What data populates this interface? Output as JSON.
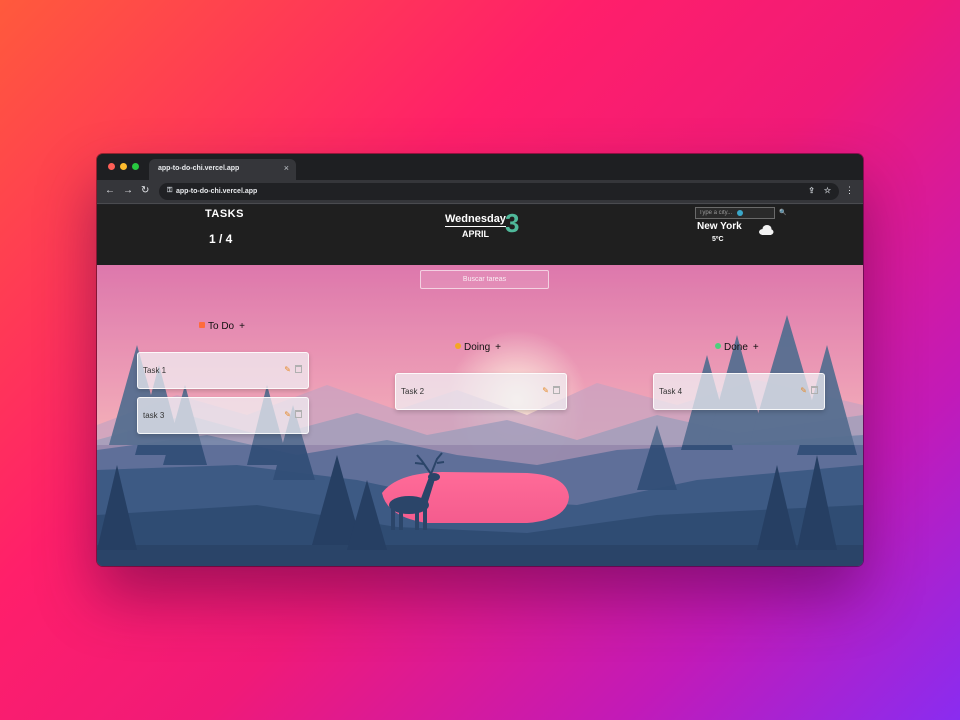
{
  "browser": {
    "tab_title": "app-to-do-chi.vercel.app",
    "url": "app-to-do-chi.vercel.app"
  },
  "header": {
    "tasks_label": "TASKS",
    "tasks_count": "1 / 4",
    "day_name": "Wednesday",
    "month": "APRIL",
    "day_number": "3",
    "city_placeholder": "Type a city...",
    "city": "New York",
    "temperature": "5ºC",
    "weather_icon": "cloud-icon"
  },
  "search": {
    "placeholder": "Buscar tareas"
  },
  "columns": [
    {
      "label": "To Do",
      "add": "+",
      "dot_color": "#ff6b3d",
      "cards": [
        {
          "title": "Task 1"
        },
        {
          "title": "task 3"
        }
      ]
    },
    {
      "label": "Doing",
      "add": "+",
      "dot_color": "#f5a623",
      "cards": [
        {
          "title": "Task 2"
        }
      ]
    },
    {
      "label": "Done",
      "add": "+",
      "dot_color": "#4cd07d",
      "cards": [
        {
          "title": "Task 4"
        }
      ]
    }
  ],
  "colors": {
    "accent": "#4fb89a",
    "header_bg": "#1f1f1f",
    "edit": "#e58a2a"
  },
  "icons": {
    "edit": "✎",
    "close": "×",
    "back": "←",
    "forward": "→",
    "reload": "↻"
  }
}
